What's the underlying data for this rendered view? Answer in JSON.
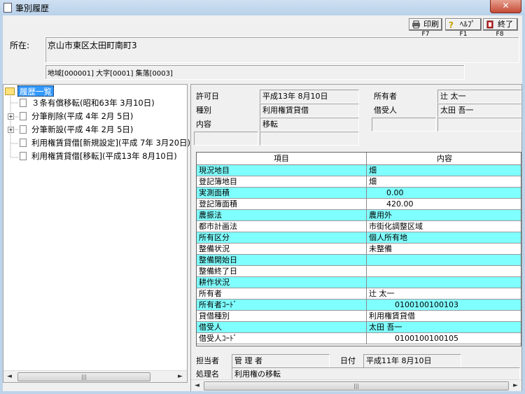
{
  "window": {
    "title": "筆別履歴",
    "close": "✕"
  },
  "toolbar": {
    "print": {
      "label": "印刷",
      "key": "F7"
    },
    "help": {
      "label": "ﾍﾙﾌﾟ",
      "key": "F1"
    },
    "exit": {
      "label": "終了",
      "key": "F8"
    }
  },
  "location": {
    "label": "所在:",
    "value": "京山市東区太田町南町3",
    "detail": "地域[000001] 大字[0001] 集落[0003]"
  },
  "tree": {
    "root": "履歴一覧",
    "items": [
      {
        "label": "３条有償移転(昭和63年 3月10日)",
        "expandable": false
      },
      {
        "label": "分筆削除(平成 4年 2月 5日)",
        "expandable": true
      },
      {
        "label": "分筆新設(平成 4年 2月 5日)",
        "expandable": true
      },
      {
        "label": "利用権賃貸借[新規設定](平成 7年 3月20日)",
        "expandable": false
      },
      {
        "label": "利用権賃貸借[移転](平成13年 8月10日)",
        "expandable": false
      }
    ]
  },
  "info": {
    "permit_date_label": "許可日",
    "permit_date": "平成13年 8月10日",
    "type_label": "種別",
    "type": "利用権賃貸借",
    "content_label": "内容",
    "content": "移転",
    "owner_label": "所有者",
    "owner": "辻 太一",
    "lessee_label": "借受人",
    "lessee": "太田 吾一"
  },
  "table": {
    "headers": [
      "項目",
      "内容"
    ],
    "rows": [
      {
        "k": "現況地目",
        "v": "畑",
        "hl": true
      },
      {
        "k": "登記簿地目",
        "v": "畑",
        "hl": false
      },
      {
        "k": "実測面積",
        "v": "0.00",
        "hl": true
      },
      {
        "k": "登記簿面積",
        "v": "420.00",
        "hl": false
      },
      {
        "k": "農振法",
        "v": "農用外",
        "hl": true
      },
      {
        "k": "都市計画法",
        "v": "市街化調整区域",
        "hl": false
      },
      {
        "k": "所有区分",
        "v": "個人所有地",
        "hl": true
      },
      {
        "k": "整備状況",
        "v": "未整備",
        "hl": false
      },
      {
        "k": "整備開始日",
        "v": "",
        "hl": true
      },
      {
        "k": "整備終了日",
        "v": "",
        "hl": false
      },
      {
        "k": "耕作状況",
        "v": "",
        "hl": true
      },
      {
        "k": "所有者",
        "v": "辻 太一",
        "hl": false
      },
      {
        "k": "所有者ｺｰﾄﾞ",
        "v": "0100100100103",
        "hl": true
      },
      {
        "k": "貸借種別",
        "v": "利用権賃貸借",
        "hl": false
      },
      {
        "k": "借受人",
        "v": "太田 吾一",
        "hl": true
      },
      {
        "k": "借受人ｺｰﾄﾞ",
        "v": "0100100100105",
        "hl": false
      }
    ]
  },
  "footer": {
    "staff_label": "担当者",
    "staff": "管 理 者",
    "date_label": "日付",
    "date": "平成11年 8月10日",
    "process_label": "処理名",
    "process": "利用権の移転"
  }
}
